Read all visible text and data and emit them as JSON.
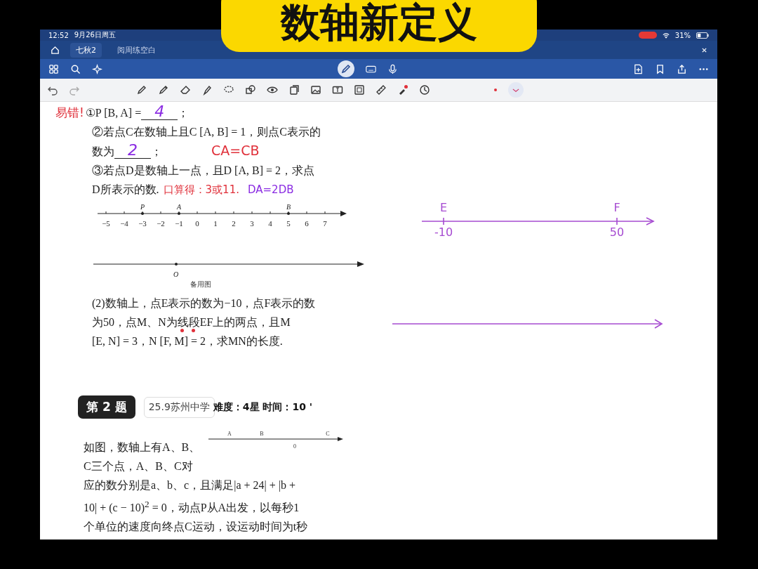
{
  "banner": {
    "title": "数轴新定义"
  },
  "status_bar": {
    "time": "12:52",
    "date": "9月26日周五",
    "battery": "31%"
  },
  "tab_bar": {
    "tabs": [
      {
        "label": "七秋2",
        "selected": true
      },
      {
        "label": "阅周练空白",
        "selected": false
      }
    ]
  },
  "question_1": {
    "lines": [
      {
        "segments": [
          {
            "kind": "note",
            "text": "易错!",
            "color": "#e0303a"
          },
          {
            "kind": "text",
            "text": "①P [B, A] = "
          },
          {
            "kind": "blank",
            "text": "4",
            "color": "#8a2be2"
          },
          {
            "kind": "text",
            "text": "；"
          }
        ]
      },
      {
        "segments": [
          {
            "kind": "text",
            "text": "②若点C在数轴上且C [A, B] = 1，则点C表示的"
          }
        ]
      },
      {
        "segments": [
          {
            "kind": "text",
            "text": "数为"
          },
          {
            "kind": "blank",
            "text": "2",
            "color": "#8a2be2"
          },
          {
            "kind": "text",
            "text": "；"
          },
          {
            "kind": "note",
            "text": "CA=CB",
            "color": "#e0303a"
          }
        ]
      },
      {
        "segments": [
          {
            "kind": "text",
            "text": "③若点D是数轴上一点，且D [A, B] = 2，求点"
          }
        ]
      },
      {
        "segments": [
          {
            "kind": "text",
            "text": "D所表示的数."
          },
          {
            "kind": "note",
            "text": "口算得：3或11.",
            "color": "#e0303a"
          },
          {
            "kind": "note",
            "text": "DA=2DB",
            "color": "#8a2be2"
          }
        ]
      }
    ],
    "number_line": {
      "ticks": [
        {
          "value": "−5"
        },
        {
          "value": "−4"
        },
        {
          "value": "−3",
          "point": "P"
        },
        {
          "value": "−2"
        },
        {
          "value": "−1",
          "point": "A"
        },
        {
          "value": "0"
        },
        {
          "value": "1"
        },
        {
          "value": "2"
        },
        {
          "value": "3"
        },
        {
          "value": "4"
        },
        {
          "value": "5",
          "point": "B"
        },
        {
          "value": "6"
        },
        {
          "value": "7"
        }
      ]
    },
    "spare_line": {
      "origin": "O",
      "caption": "备用图"
    },
    "part_2": [
      {
        "segments": [
          {
            "kind": "text",
            "text": "(2)数轴上，点E表示的数为−10，点F表示的数"
          }
        ]
      },
      {
        "segments": [
          {
            "kind": "text",
            "text": "为50，点M、N为"
          },
          {
            "kind": "dotted",
            "text": "线段",
            "color": "#e0303a"
          },
          {
            "kind": "text",
            "text": "EF上的两点，且M"
          }
        ]
      },
      {
        "segments": [
          {
            "kind": "text",
            "text": "[E, N] = 3，N [F, M] = 2，求MN的长度."
          }
        ]
      }
    ]
  },
  "sketch": {
    "points": [
      {
        "name": "E",
        "value": "-10"
      },
      {
        "name": "F",
        "value": "50"
      }
    ]
  },
  "question_2": {
    "badge": "第 2 题",
    "source": "25.9苏州中学",
    "meta": "难度：4星  时间：10 '",
    "lines": [
      {
        "segments": [
          {
            "kind": "text",
            "text": "如图，数轴上有A、B、"
          }
        ]
      },
      {
        "segments": [
          {
            "kind": "text",
            "text": "C三个点，A、B、C对"
          }
        ]
      },
      {
        "segments": [
          {
            "kind": "text",
            "text": "应的数分别是a、b、c，且满足|a + 24| + |b +"
          }
        ]
      },
      {
        "segments": [
          {
            "kind": "text",
            "text": "10| + (c − 10)$^{2}$ = 0，动点P从A出发，以每秒1"
          }
        ]
      },
      {
        "segments": [
          {
            "kind": "text",
            "text": "个单位的速度向终点C运动，设运动时间为t秒"
          }
        ]
      }
    ],
    "mini_line": {
      "points": [
        {
          "label": "A",
          "kind": "point"
        },
        {
          "label": "B",
          "kind": "point"
        },
        {
          "label": "0",
          "kind": "origin"
        },
        {
          "label": "C",
          "kind": "point"
        }
      ]
    }
  }
}
